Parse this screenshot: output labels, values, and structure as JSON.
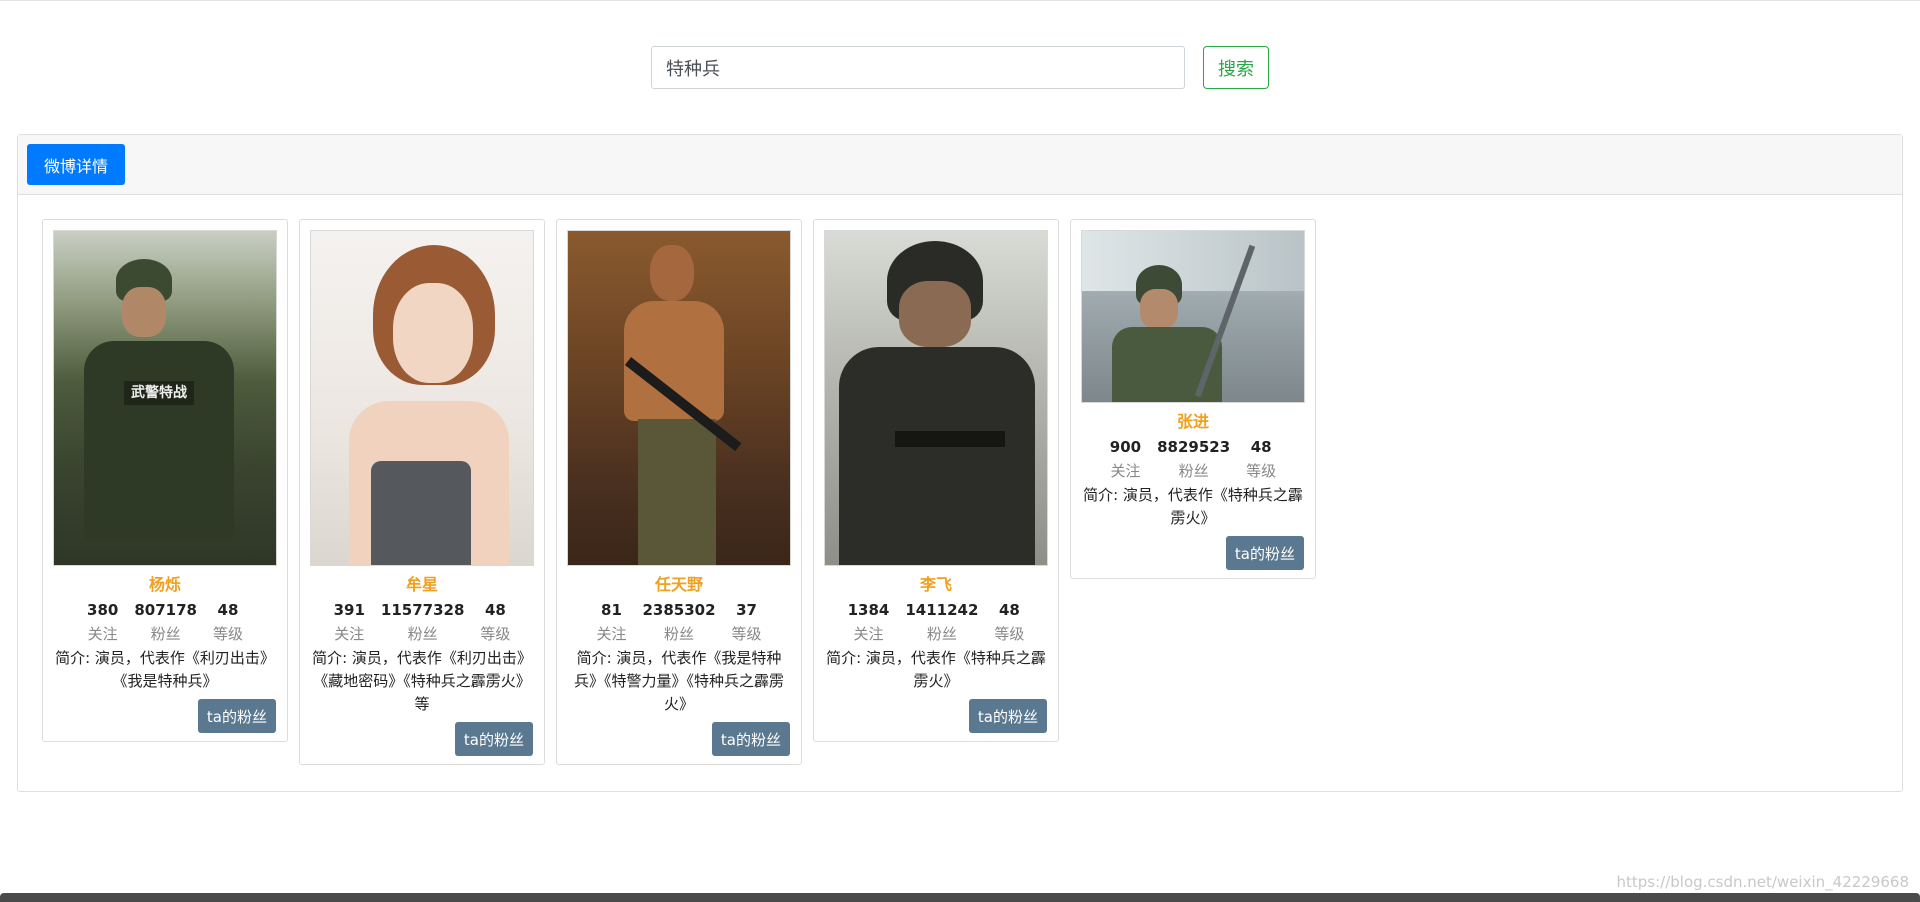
{
  "search": {
    "value": "特种兵",
    "button_label": "搜索"
  },
  "panel": {
    "tab_label": "微博详情"
  },
  "stat_labels": {
    "follow": "关注",
    "fans": "粉丝",
    "level": "等级"
  },
  "fans_button_label": "ta的粉丝",
  "cards": [
    {
      "name": "杨烁",
      "follow": "380",
      "fans": "807178",
      "level": "48",
      "intro": "简介: 演员，代表作《利刃出击》《我是特种兵》"
    },
    {
      "name": "牟星",
      "follow": "391",
      "fans": "11577328",
      "level": "48",
      "intro": "简介: 演员，代表作《利刃出击》《藏地密码》《特种兵之霹雳火》等"
    },
    {
      "name": "任天野",
      "follow": "81",
      "fans": "2385302",
      "level": "37",
      "intro": "简介: 演员，代表作《我是特种兵》《特警力量》《特种兵之霹雳火》"
    },
    {
      "name": "李飞",
      "follow": "1384",
      "fans": "1411242",
      "level": "48",
      "intro": "简介: 演员，代表作《特种兵之霹雳火》"
    },
    {
      "name": "张进",
      "follow": "900",
      "fans": "8829523",
      "level": "48",
      "intro": "简介: 演员，代表作《特种兵之霹雳火》"
    }
  ],
  "watermark": "https://blog.csdn.net/weixin_42229668",
  "colors": {
    "primary": "#007bff",
    "success": "#28a745",
    "name": "#f0a020",
    "fans_button": "#5a7890"
  }
}
